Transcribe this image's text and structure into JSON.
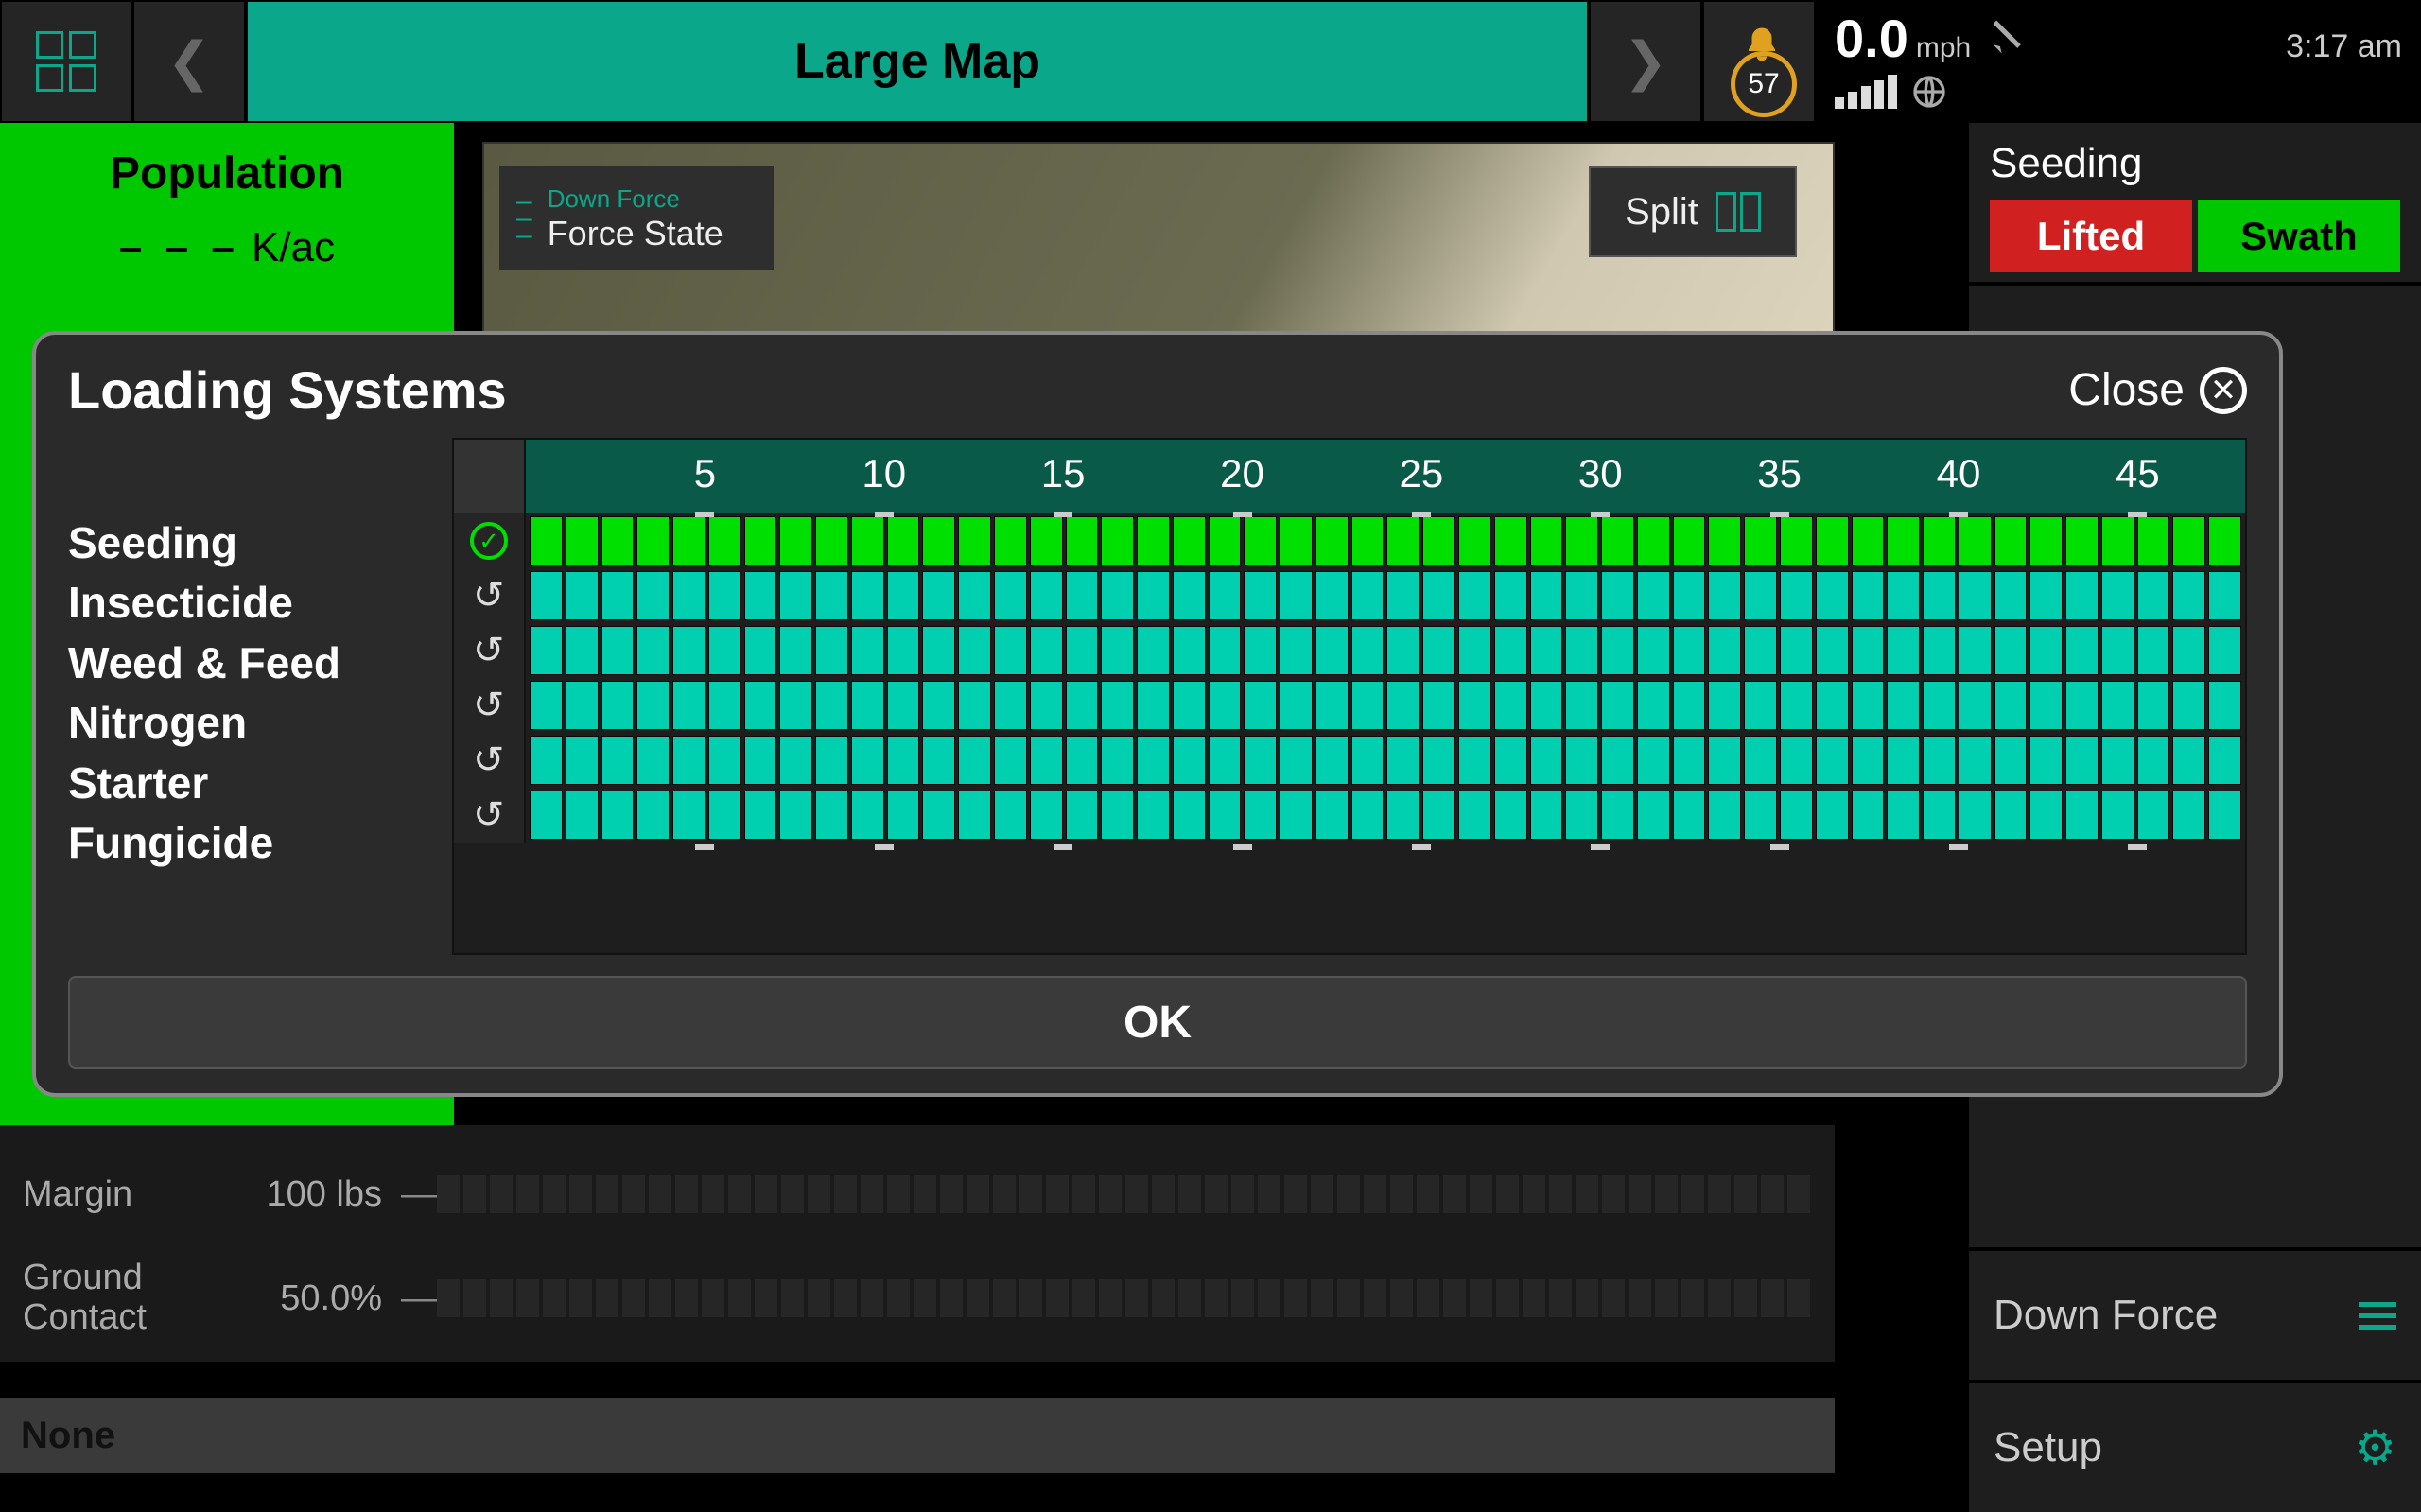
{
  "topbar": {
    "title": "Large Map",
    "alert_count": "57",
    "speed_value": "0.0",
    "speed_unit": "mph",
    "clock": "3:17 am"
  },
  "left": {
    "population_title": "Population",
    "population_unit": "K/ac",
    "population_dashes": "– – –"
  },
  "map_controls": {
    "force_small": "Down Force",
    "force_big": "Force State",
    "split_label": "Split"
  },
  "right": {
    "seeding_title": "Seeding",
    "lifted": "Lifted",
    "swath": "Swath",
    "downforce": "Down Force",
    "setup": "Setup"
  },
  "metrics": {
    "margin_label": "Margin",
    "margin_value": "100 lbs",
    "ground_label": "Ground Contact",
    "ground_value": "50.0%",
    "none": "None"
  },
  "modal": {
    "title": "Loading Systems",
    "close": "Close",
    "ok": "OK",
    "systems": [
      "Seeding",
      "Insecticide",
      "Weed & Feed",
      "Nitrogen",
      "Starter",
      "Fungicide"
    ],
    "column_labels": [
      "5",
      "10",
      "15",
      "20",
      "25",
      "30",
      "35",
      "40",
      "45"
    ],
    "columns_total": 48
  },
  "chart_data": {
    "type": "heatmap",
    "title": "Loading Systems",
    "x": {
      "count": 48,
      "tick_labels": [
        5,
        10,
        15,
        20,
        25,
        30,
        35,
        40,
        45
      ]
    },
    "series": [
      {
        "name": "Seeding",
        "status": "complete",
        "cells_loaded": 48
      },
      {
        "name": "Insecticide",
        "status": "in-progress",
        "cells_loaded": 48
      },
      {
        "name": "Weed & Feed",
        "status": "in-progress",
        "cells_loaded": 48
      },
      {
        "name": "Nitrogen",
        "status": "in-progress",
        "cells_loaded": 48
      },
      {
        "name": "Starter",
        "status": "in-progress",
        "cells_loaded": 48
      },
      {
        "name": "Fungicide",
        "status": "in-progress",
        "cells_loaded": 48
      }
    ],
    "colors": {
      "complete": "#00e000",
      "in-progress": "#00d0b0"
    }
  }
}
